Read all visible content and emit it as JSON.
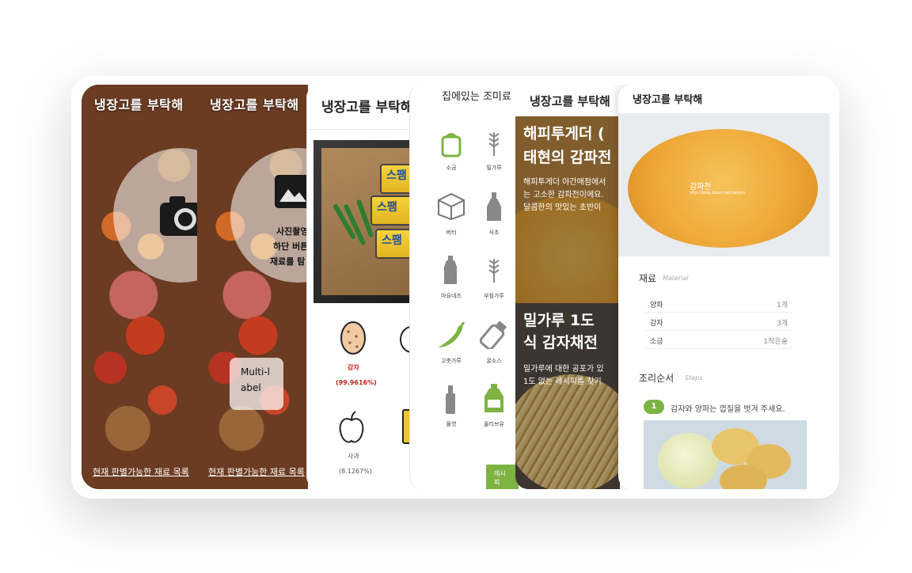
{
  "app_title": "냉장고를 부탁해",
  "screens": {
    "camera": {
      "title": "냉장고를 부탁해",
      "icon": "camera-icon",
      "bottom_link": "현재 판별가능한 재료 목록"
    },
    "gallery": {
      "title": "냉장고를 부탁해",
      "icon": "image-icon",
      "overlay_lines": [
        "사진촬영",
        "하단 버튼",
        "재료를 탐"
      ],
      "multi_label": "Multi-label",
      "bottom_link": "현재 판별가능한 재료 목록"
    },
    "result": {
      "title": "냉장고를 부탁해",
      "can_text": "스팸",
      "items": [
        {
          "name": "감자",
          "score": "(99.9616%)",
          "icon": "potato-icon",
          "highlight": true
        },
        {
          "name": "사과",
          "score": "(8.1267%)",
          "icon": "apple-icon",
          "highlight": false
        }
      ]
    },
    "seasoning": {
      "title": "집에있는 조미료",
      "items": [
        {
          "label": "소금",
          "icon": "salt-icon",
          "active": true
        },
        {
          "label": "밀가루",
          "icon": "wheat-icon",
          "active": false
        },
        {
          "label": "버터",
          "icon": "butter-icon",
          "active": false
        },
        {
          "label": "식초",
          "icon": "vinegar-icon",
          "active": false
        },
        {
          "label": "마요네즈",
          "icon": "mayo-icon",
          "active": false
        },
        {
          "label": "부침가루",
          "icon": "flour-icon",
          "active": false
        },
        {
          "label": "고춧가루",
          "icon": "chili-icon",
          "active": true
        },
        {
          "label": "굴소스",
          "icon": "sauce-icon",
          "active": false
        },
        {
          "label": "물엿",
          "icon": "syrup-icon",
          "active": false
        },
        {
          "label": "올리브유",
          "icon": "oil-icon",
          "active": true
        }
      ],
      "button_label": "레시피"
    },
    "recipe_list": {
      "title": "냉장고를 부탁해",
      "recipes": [
        {
          "title_lines": [
            "해피투게더 (",
            "태현의 감파전"
          ],
          "body_lines": [
            "해피투게더 야간매점에서",
            "는 고소한 감파전이에요.",
            "달콤한의 맛있는 초반이"
          ]
        },
        {
          "title_lines": [
            "밀가루 1도 ",
            "식 감자채전"
          ],
          "body_lines": [
            "밀가루에 대한 공포가 있",
            "1도 없는 레시피를 찾기"
          ]
        }
      ]
    },
    "recipe_detail": {
      "title": "냉장고를 부탁해",
      "photo_caption": "감파전",
      "photo_url_caption": "http://blog.daum.net/dellym",
      "ingredients_title": "재료",
      "ingredients_sub": "Material",
      "ingredients": [
        {
          "name": "양파",
          "amount": "1개"
        },
        {
          "name": "감자",
          "amount": "3개"
        },
        {
          "name": "소금",
          "amount": "1작은술"
        }
      ],
      "steps_title": "조리순서",
      "steps_sub": "Steps",
      "steps": [
        {
          "number": "1",
          "text": "감자와 양파는 껍질을 벗겨 주세요."
        }
      ]
    }
  },
  "colors": {
    "accent_green": "#7cb342",
    "score_red": "#cc1f1f"
  }
}
